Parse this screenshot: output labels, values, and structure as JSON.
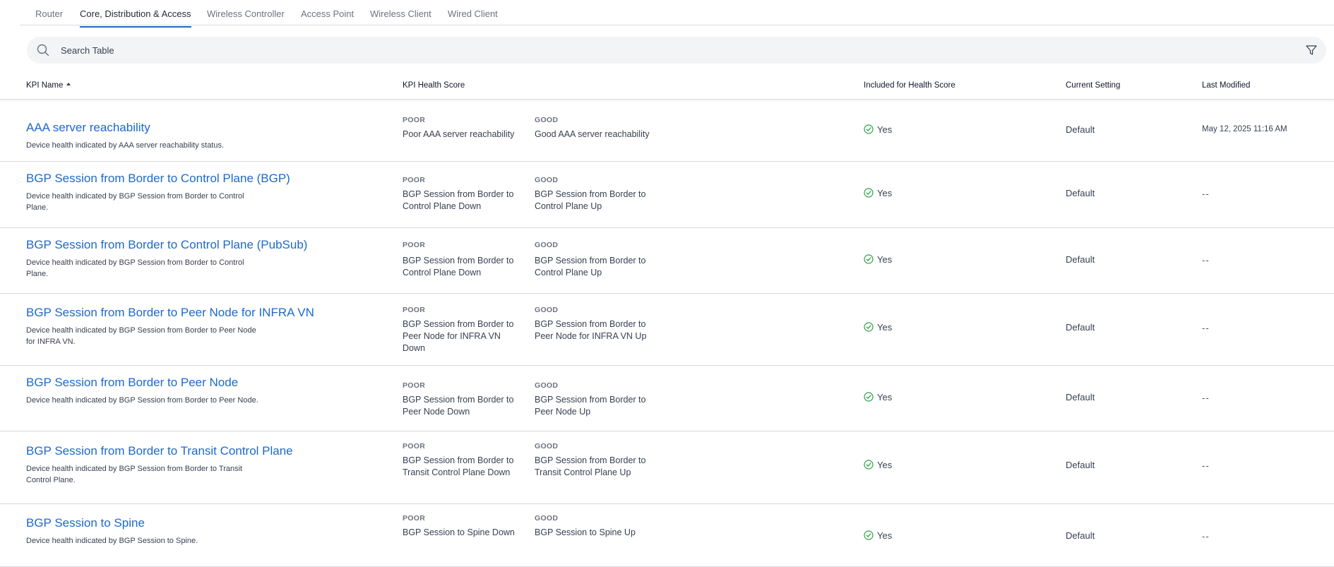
{
  "tabs": [
    {
      "label": "Router"
    },
    {
      "label": "Core, Distribution & Access",
      "active": true
    },
    {
      "label": "Wireless Controller"
    },
    {
      "label": "Access Point"
    },
    {
      "label": "Wireless Client"
    },
    {
      "label": "Wired Client"
    }
  ],
  "search": {
    "placeholder": "Search Table",
    "value": ""
  },
  "table": {
    "headers": {
      "kpi_name": "KPI Name",
      "health_score": "KPI Health Score",
      "included": "Included for Health Score",
      "setting": "Current Setting",
      "modified": "Last Modified"
    },
    "poor_label": "POOR",
    "good_label": "GOOD",
    "rows": [
      {
        "name": "AAA server reachability",
        "desc": "Device health indicated by AAA server reachability status.",
        "poor": "Poor AAA server reachability",
        "good": "Good AAA server reachability",
        "included": "Yes",
        "setting": "Default",
        "modified": "May 12, 2025 11:16 AM"
      },
      {
        "name": "BGP Session from Border to Control Plane (BGP)",
        "desc": "Device health indicated by BGP Session from Border to Control Plane.",
        "poor": "BGP Session from Border to Control Plane Down",
        "good": "BGP Session from Border to Control Plane Up",
        "included": "Yes",
        "setting": "Default",
        "modified": "--"
      },
      {
        "name": "BGP Session from Border to Control Plane (PubSub)",
        "desc": "Device health indicated by BGP Session from Border to Control Plane.",
        "poor": "BGP Session from Border to Control Plane Down",
        "good": "BGP Session from Border to Control Plane Up",
        "included": "Yes",
        "setting": "Default",
        "modified": "--"
      },
      {
        "name": "BGP Session from Border to Peer Node for INFRA VN",
        "desc": "Device health indicated by BGP Session from Border to Peer Node for INFRA VN.",
        "poor": "BGP Session from Border to Peer Node for INFRA VN Down",
        "good": "BGP Session from Border to Peer Node for INFRA VN Up",
        "included": "Yes",
        "setting": "Default",
        "modified": "--"
      },
      {
        "name": "BGP Session from Border to Peer Node",
        "desc": "Device health indicated by BGP Session from Border to Peer Node.",
        "poor": "BGP Session from Border to Peer Node Down",
        "good": "BGP Session from Border to Peer Node Up",
        "included": "Yes",
        "setting": "Default",
        "modified": "--"
      },
      {
        "name": "BGP Session from Border to Transit Control Plane",
        "desc": "Device health indicated by BGP Session from Border to Transit Control Plane.",
        "poor": "BGP Session from Border to Transit Control Plane Down",
        "good": "BGP Session from Border to Transit Control Plane Up",
        "included": "Yes",
        "setting": "Default",
        "modified": "--"
      },
      {
        "name": "BGP Session to Spine",
        "desc": "Device health indicated by BGP Session to Spine.",
        "poor": "BGP Session to Spine Down",
        "good": "BGP Session to Spine Up",
        "included": "Yes",
        "setting": "Default",
        "modified": "--"
      }
    ]
  },
  "colors": {
    "link": "#1d69cc",
    "check": "#2e9e47",
    "active_tab": "#1d69cc"
  },
  "icons": {
    "search": "search-icon",
    "filter": "filter-icon",
    "included": "check-circle-icon"
  }
}
